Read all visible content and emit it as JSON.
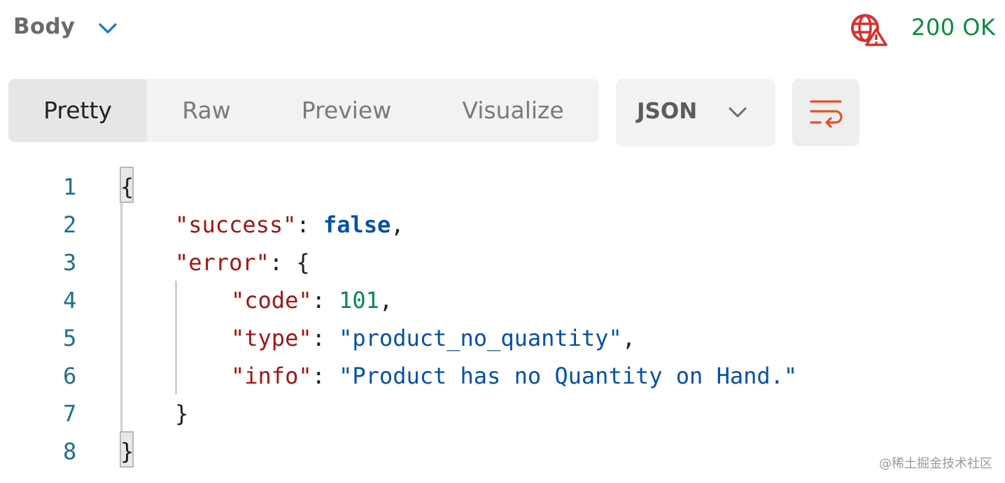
{
  "header": {
    "section_label": "Body",
    "status": "200 OK",
    "status_color": "#0b8a3e",
    "globe_icon": "globe-warning-icon",
    "globe_color": "#d9302c"
  },
  "tabs": [
    {
      "label": "Pretty",
      "active": true
    },
    {
      "label": "Raw",
      "active": false
    },
    {
      "label": "Preview",
      "active": false
    },
    {
      "label": "Visualize",
      "active": false
    }
  ],
  "format_select": {
    "value": "JSON"
  },
  "wrap_button": {
    "icon": "wrap-lines-icon",
    "color": "#e0532b"
  },
  "code": {
    "line_numbers": [
      "1",
      "2",
      "3",
      "4",
      "5",
      "6",
      "7",
      "8"
    ],
    "l1": {
      "open": "{"
    },
    "l2": {
      "key": "\"success\"",
      "sep": ": ",
      "value": "false",
      "end": ","
    },
    "l3": {
      "key": "\"error\"",
      "sep": ": ",
      "open": "{"
    },
    "l4": {
      "key": "\"code\"",
      "sep": ": ",
      "value": "101",
      "end": ","
    },
    "l5": {
      "key": "\"type\"",
      "sep": ": ",
      "value": "\"product_no_quantity\"",
      "end": ","
    },
    "l6": {
      "key": "\"info\"",
      "sep": ": ",
      "value": "\"Product has no Quantity on Hand.\""
    },
    "l7": {
      "close": "}"
    },
    "l8": {
      "close": "}"
    }
  },
  "watermark": "@稀土掘金技术社区"
}
